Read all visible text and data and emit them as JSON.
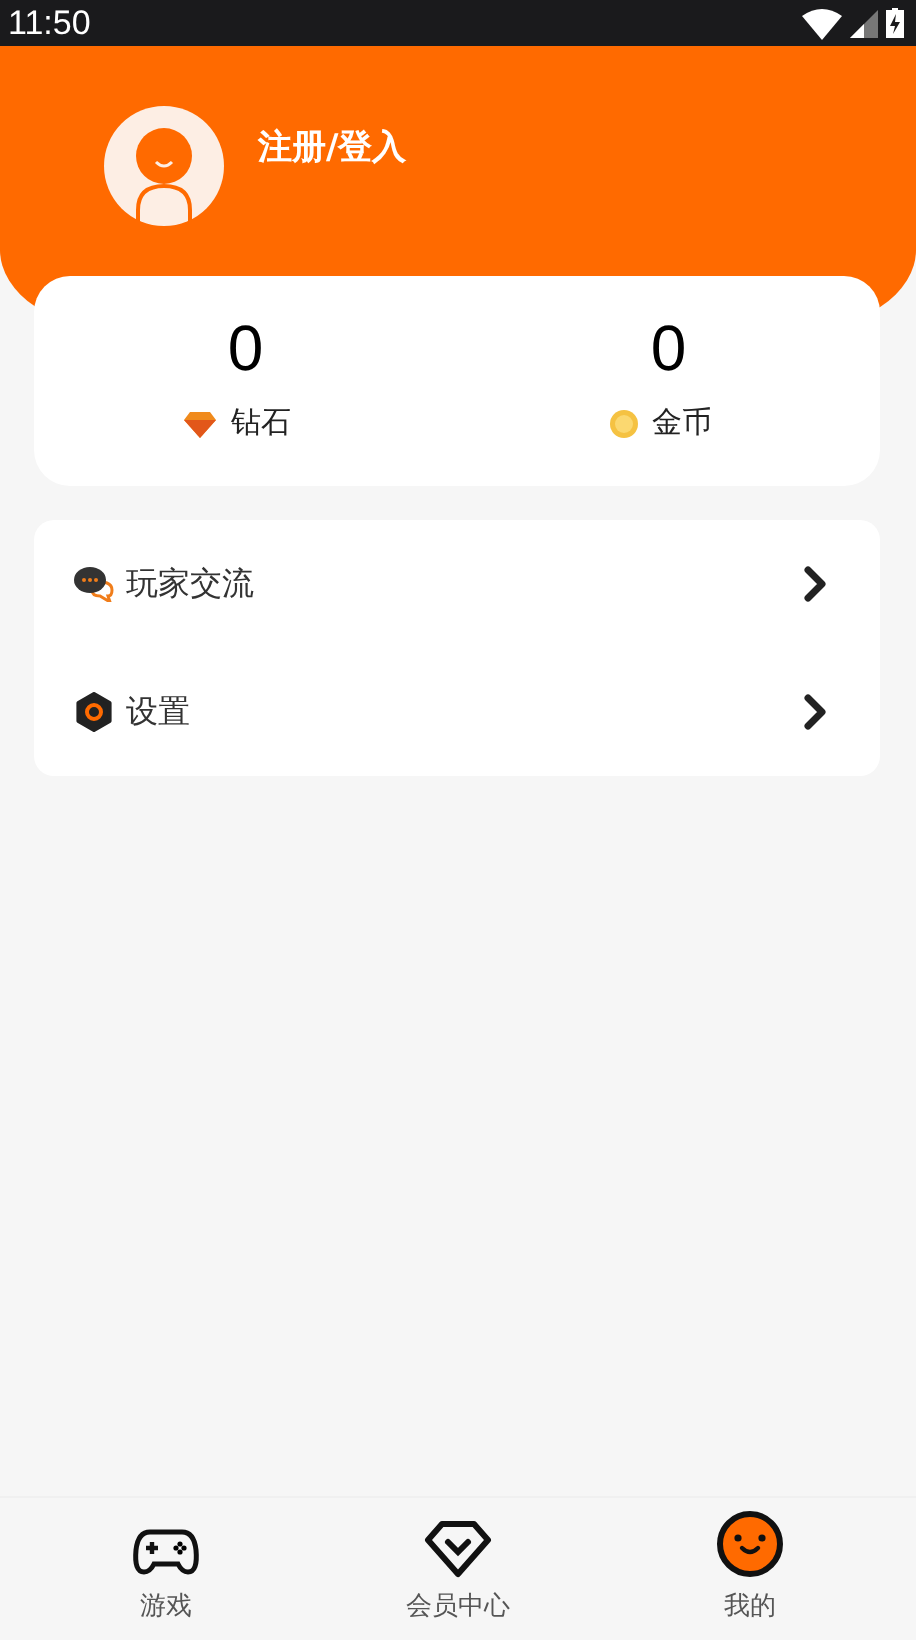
{
  "status_bar": {
    "time": "11:50"
  },
  "profile": {
    "login_label": "注册/登入"
  },
  "stats": [
    {
      "kind": "diamond",
      "value": "0",
      "label": "钻石"
    },
    {
      "kind": "coin",
      "value": "0",
      "label": "金币"
    }
  ],
  "menu": [
    {
      "kind": "chat",
      "label": "玩家交流"
    },
    {
      "kind": "settings",
      "label": "设置"
    }
  ],
  "tabs": [
    {
      "kind": "game",
      "label": "游戏",
      "selected": false
    },
    {
      "kind": "vip",
      "label": "会员中心",
      "selected": false
    },
    {
      "kind": "me",
      "label": "我的",
      "selected": true
    }
  ]
}
